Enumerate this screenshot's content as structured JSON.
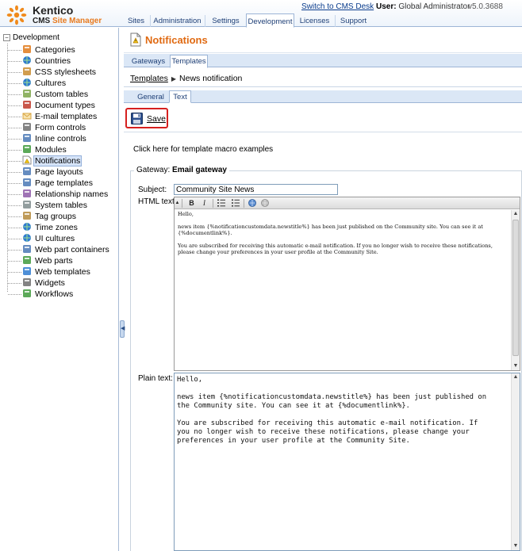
{
  "header": {
    "logo_line1": "Kentico",
    "logo_line2_prefix": "CMS",
    "logo_line2_accent": "Site Manager",
    "switch_link": "Switch to CMS Desk",
    "user_label": "User:",
    "user_name": "Global Administrator",
    "version": "v5.0.3688",
    "tabs": [
      {
        "label": "Sites"
      },
      {
        "label": "Administration"
      },
      {
        "label": "Settings"
      },
      {
        "label": "Development",
        "active": true
      },
      {
        "label": "Licenses"
      },
      {
        "label": "Support"
      }
    ]
  },
  "tree": {
    "root": "Development",
    "items": [
      {
        "label": "Categories",
        "icon": "categories-icon"
      },
      {
        "label": "Countries",
        "icon": "globe-icon"
      },
      {
        "label": "CSS stylesheets",
        "icon": "brush-icon"
      },
      {
        "label": "Cultures",
        "icon": "globe-icon"
      },
      {
        "label": "Custom tables",
        "icon": "table-icon"
      },
      {
        "label": "Document types",
        "icon": "cube-icon"
      },
      {
        "label": "E-mail templates",
        "icon": "envelope-icon"
      },
      {
        "label": "Form controls",
        "icon": "pencil-icon"
      },
      {
        "label": "Inline controls",
        "icon": "window-icon"
      },
      {
        "label": "Modules",
        "icon": "puzzle-icon"
      },
      {
        "label": "Notifications",
        "icon": "notification-icon",
        "selected": true
      },
      {
        "label": "Page layouts",
        "icon": "layout-icon"
      },
      {
        "label": "Page templates",
        "icon": "template-icon"
      },
      {
        "label": "Relationship names",
        "icon": "relationship-icon"
      },
      {
        "label": "System tables",
        "icon": "grid-icon"
      },
      {
        "label": "Tag groups",
        "icon": "tag-icon"
      },
      {
        "label": "Time zones",
        "icon": "clock-icon"
      },
      {
        "label": "UI cultures",
        "icon": "globe-icon"
      },
      {
        "label": "Web part containers",
        "icon": "container-icon"
      },
      {
        "label": "Web parts",
        "icon": "webpart-icon"
      },
      {
        "label": "Web templates",
        "icon": "webtemplate-icon"
      },
      {
        "label": "Widgets",
        "icon": "widget-icon"
      },
      {
        "label": "Workflows",
        "icon": "workflow-icon"
      }
    ]
  },
  "page": {
    "title": "Notifications",
    "tabs": [
      {
        "label": "Gateways"
      },
      {
        "label": "Templates",
        "active": true
      }
    ],
    "breadcrumb_link": "Templates",
    "breadcrumb_current": "News notification",
    "tabs2": [
      {
        "label": "General"
      },
      {
        "label": "Text",
        "active": true
      }
    ],
    "save_label": "Save",
    "macro_link": "Click here for template macro examples",
    "gateway_label": "Gateway:",
    "gateway_value": "Email gateway",
    "subject_label": "Subject:",
    "subject_value": "Community Site News",
    "html_label": "HTML text:",
    "html_paragraphs": [
      "Hello,",
      "news item {%notificationcustomdata.newstitle%} has been just published on the Community site. You can see it at {%documentlink%}.",
      "You are subscribed for receiving this automatic e-mail notification. If you no longer wish to receive these notifications, please change your preferences in your user profile at the Community Site."
    ],
    "plain_label": "Plain text:",
    "plain_text": "Hello,\n\nnews item {%notificationcustomdata.newstitle%} has been just published on\nthe Community site. You can see it at {%documentlink%}.\n\nYou are subscribed for receiving this automatic e-mail notification. If\nyou no longer wish to receive these notifications, please change your\npreferences in your user profile at the Community Site."
  }
}
